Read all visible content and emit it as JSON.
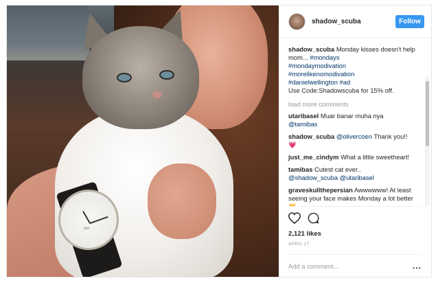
{
  "post": {
    "username": "shadow_scuba",
    "follow_label": "Follow",
    "caption": {
      "username": "shadow_scuba",
      "text_lines": [
        "Monday kisses doesn't help mom...",
        "#mondays",
        "#mondaymodivation",
        "#morelikenomodivation",
        "#danielwellington",
        "#ad",
        "Use Code:Shadowscuba for 15% off."
      ]
    },
    "load_more": "load more comments",
    "comments": [
      {
        "user": "utaribasel",
        "text": "Muar banar muha nya",
        "mention": "@tamibas"
      },
      {
        "user": "shadow_scuba",
        "mention": "@olivercoen",
        "text": "Thank you!!",
        "emoji": "💗"
      },
      {
        "user": "just_me_cindym",
        "text": "What a little sweetheart!"
      },
      {
        "user": "tamibas",
        "text": "Cutest cat ever..",
        "mention": "@shadow_scuba",
        "mention2": "@utaribasel"
      },
      {
        "user": "graveskullthepersian",
        "text": "Awwwwww! At least seeing your face makes Monday a lot better",
        "emoji": "😺"
      }
    ],
    "likes": "2,121 likes",
    "date": "APRIL 17",
    "add_comment_placeholder": "Add a comment...",
    "more_label": "...",
    "watch_brand": "DW",
    "colors": {
      "follow_bg": "#3897f0",
      "hashtag": "#003569",
      "muted": "#999999",
      "text": "#262626"
    },
    "icons": [
      "heart-icon",
      "comment-icon",
      "more-options-icon"
    ]
  }
}
